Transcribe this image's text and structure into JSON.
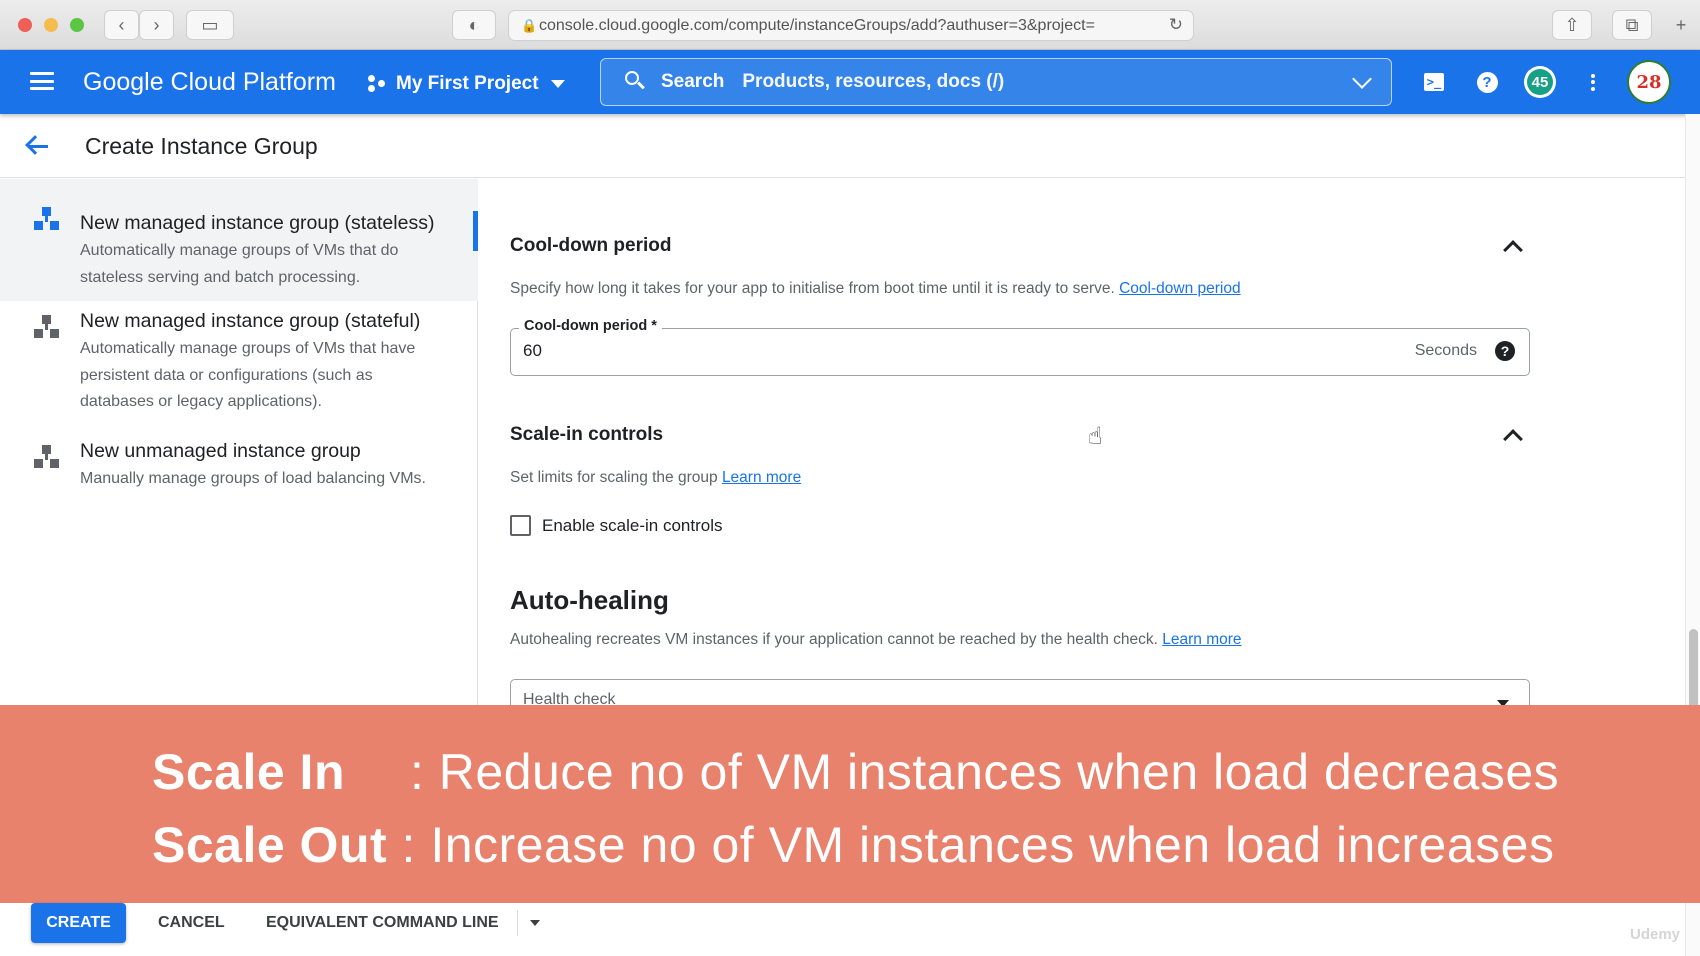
{
  "browser": {
    "url": "console.cloud.google.com/compute/instanceGroups/add?authuser=3&project=",
    "buttons": [
      "back-button",
      "forward-button",
      "sidebar-button",
      "share-button",
      "tabs-button",
      "new-tab-button"
    ]
  },
  "header": {
    "title": "Google Cloud Platform",
    "project": "My First Project",
    "search_label": "Search",
    "search_placeholder": "Products, resources, docs (/)",
    "notification_count": "45",
    "avatar_text": "28",
    "help_glyph": "?"
  },
  "page": {
    "title": "Create Instance Group"
  },
  "types": [
    {
      "name": "New managed instance group (stateless)",
      "description": "Automatically manage groups of VMs that do stateless serving and batch processing.",
      "selected": true
    },
    {
      "name": "New managed instance group (stateful)",
      "description": "Automatically manage groups of VMs that have persistent data or configurations (such as databases or legacy applications).",
      "selected": false
    },
    {
      "name": "New unmanaged instance group",
      "description": "Manually manage groups of load balancing VMs.",
      "selected": false
    }
  ],
  "cooldown": {
    "heading": "Cool-down period",
    "description": "Specify how long it takes for your app to initialise from boot time until it is ready to serve.",
    "link": "Cool-down period",
    "field_label": "Cool-down period *",
    "value": "60",
    "suffix": "Seconds",
    "help_glyph": "?"
  },
  "scale_in": {
    "heading": "Scale-in controls",
    "description": "Set limits for scaling the group",
    "link": "Learn more",
    "checkbox_label": "Enable scale-in controls",
    "checked": false
  },
  "autohealing": {
    "heading": "Auto-healing",
    "description": "Autohealing recreates VM instances if your application cannot be reached by the health check.",
    "link": "Learn more",
    "dropdown_label": "Health check"
  },
  "overlay": {
    "line1_term": "Scale In",
    "line1_text": ": Reduce no of VM instances when load decreases",
    "line2_term": "Scale Out",
    "line2_text": ": Increase no of VM instances when load increases"
  },
  "footer": {
    "create": "CREATE",
    "cancel": "CANCEL",
    "command_line": "EQUIVALENT COMMAND LINE"
  },
  "colors": {
    "brand_blue": "#1a73e8",
    "overlay": "#e8826c"
  },
  "icons": [
    "hamburger-icon",
    "project-icon",
    "search-icon",
    "cloud-shell-icon",
    "help-icon",
    "kebab-icon",
    "back-arrow-icon",
    "instance-group-icon",
    "chevron-up-icon",
    "help-circle-icon",
    "dropdown-caret-icon"
  ]
}
